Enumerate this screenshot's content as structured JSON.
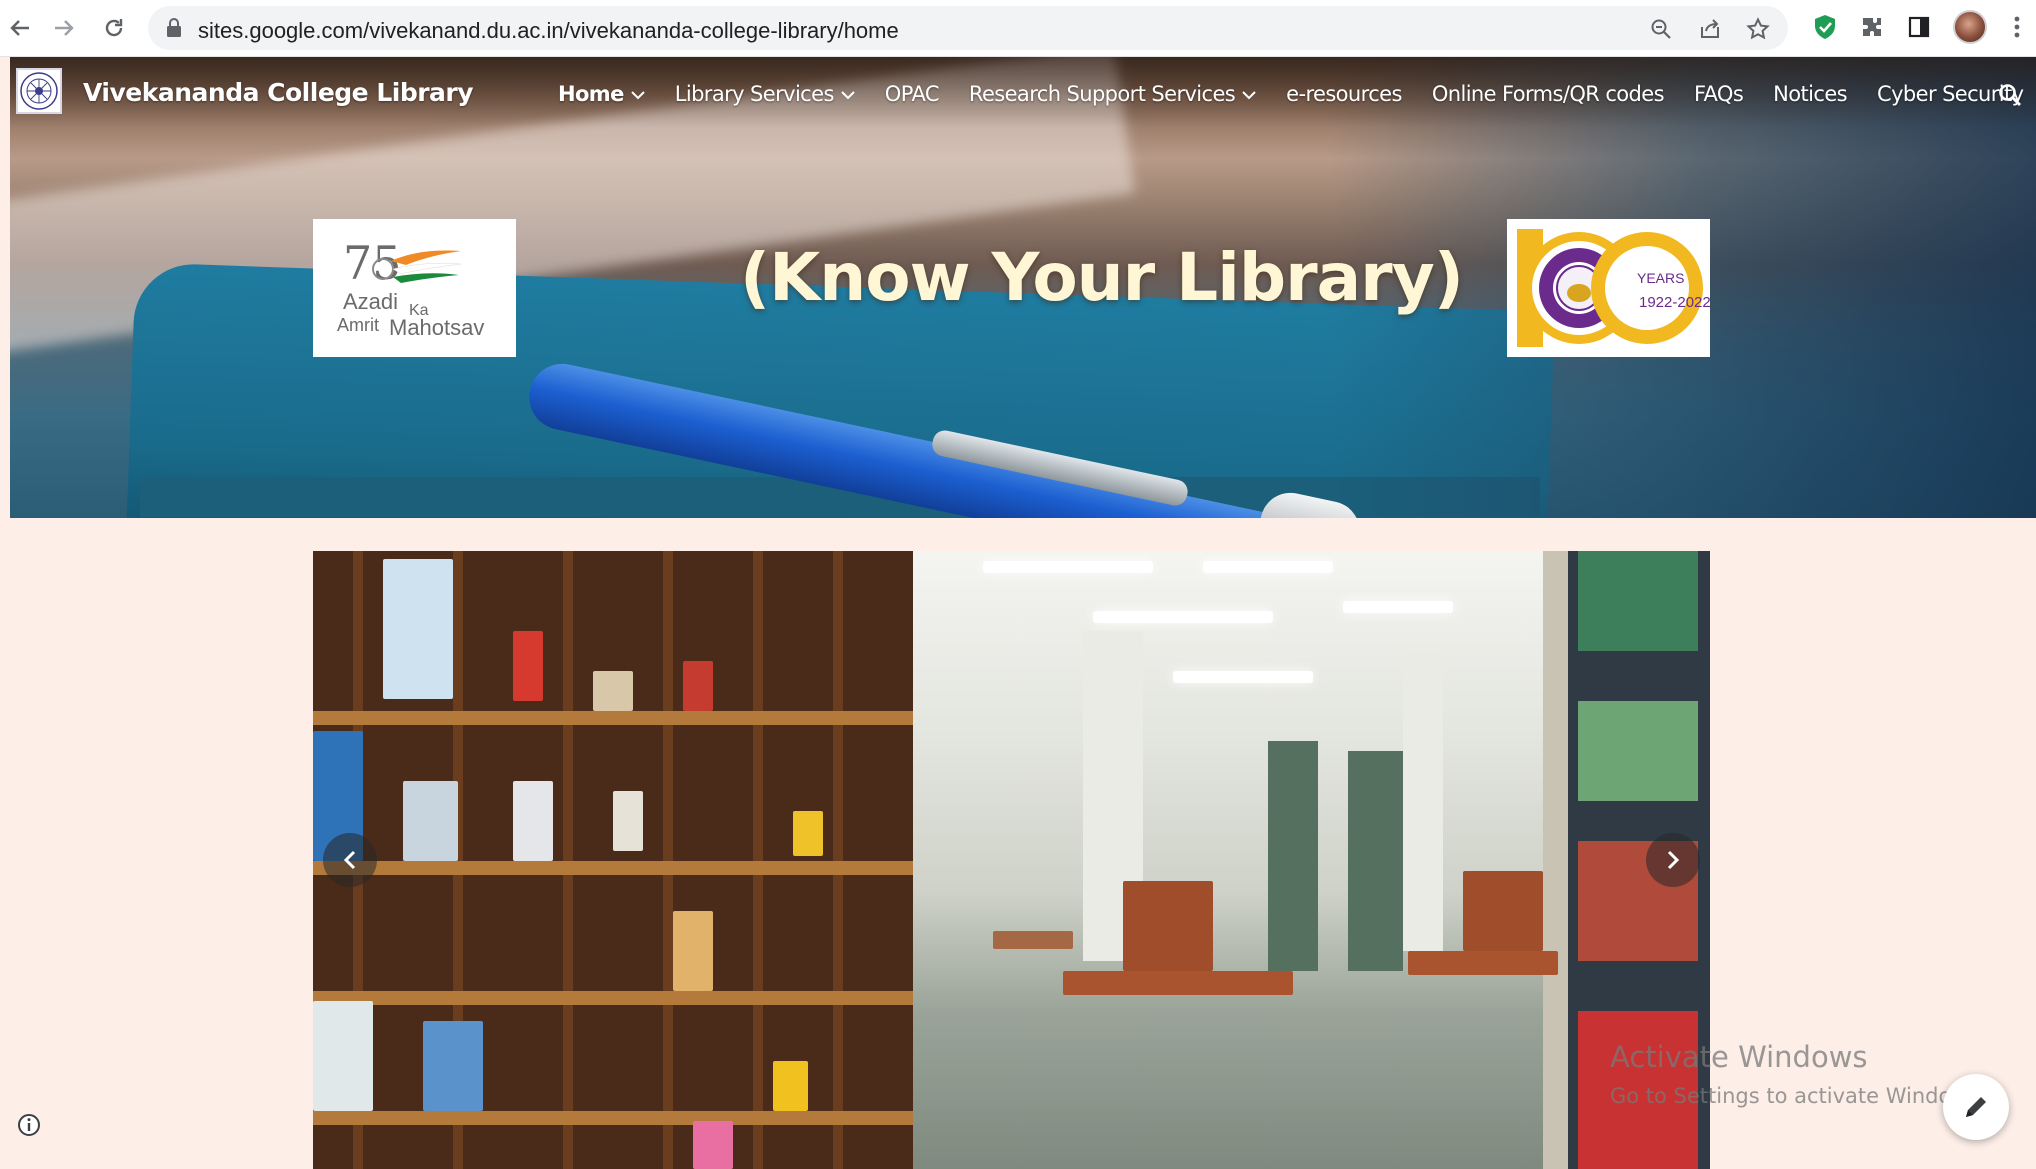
{
  "browser": {
    "url": "sites.google.com/vivekanand.du.ac.in/vivekananda-college-library/home",
    "icons": [
      "back-icon",
      "forward-icon",
      "reload-icon",
      "lock-icon",
      "zoom-icon",
      "share-icon",
      "bookmark-star-icon",
      "extension-shield-icon",
      "extensions-puzzle-icon",
      "side-panel-icon",
      "profile-avatar",
      "menu-kebab-icon"
    ]
  },
  "site": {
    "title": "Vivekananda College Library",
    "nav": [
      {
        "label": "Home",
        "has_dropdown": true,
        "active": true
      },
      {
        "label": "Library Services",
        "has_dropdown": true,
        "active": false
      },
      {
        "label": "OPAC",
        "has_dropdown": false,
        "active": false
      },
      {
        "label": "Research Support Services",
        "has_dropdown": true,
        "active": false
      },
      {
        "label": "e-resources",
        "has_dropdown": false,
        "active": false
      },
      {
        "label": "Online Forms/QR codes",
        "has_dropdown": false,
        "active": false
      },
      {
        "label": "FAQs",
        "has_dropdown": false,
        "active": false
      },
      {
        "label": "Notices",
        "has_dropdown": false,
        "active": false
      },
      {
        "label": "Cyber Security",
        "has_dropdown": false,
        "active": false
      }
    ]
  },
  "hero": {
    "heading": "(Know Your Library)",
    "left_logo": {
      "number": "75",
      "line1": "Azadi",
      "line2": "Ka",
      "line3": "Amrit",
      "line4": "Mahotsav"
    },
    "right_logo": {
      "line1": "YEARS",
      "line2": "1922-2022"
    }
  },
  "overlay": {
    "watermark_title": "Activate Windows",
    "watermark_sub": "Go to Settings to activate Windows."
  },
  "colors": {
    "page_bg": "#fdeee8",
    "heading_color": "#fff6d6",
    "accent_saffron": "#f08a24",
    "accent_green": "#1b8a3a",
    "du_purple": "#6a2b8c",
    "du_gold": "#f2b820"
  }
}
